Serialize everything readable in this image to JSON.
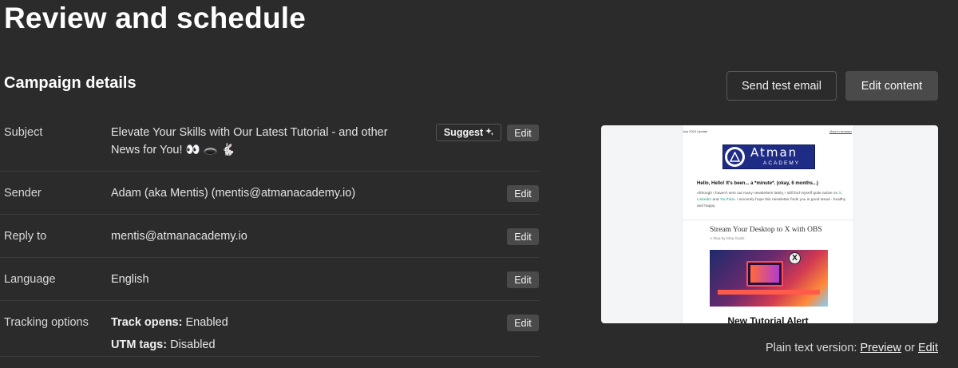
{
  "page": {
    "title": "Review and schedule"
  },
  "campaign": {
    "section_title": "Campaign details",
    "send_test_label": "Send test email",
    "edit_content_label": "Edit content",
    "suggest_label": "Suggest",
    "edit_label": "Edit",
    "rows": {
      "subject": {
        "label": "Subject",
        "value_line1": "Elevate Your Skills with Our Latest Tutorial - and other",
        "value_line2": "News for You! 👀 🕳️ 🐇"
      },
      "sender": {
        "label": "Sender",
        "value": "Adam (aka Mentis) (mentis@atmanacademy.io)"
      },
      "reply_to": {
        "label": "Reply to",
        "value": "mentis@atmanacademy.io"
      },
      "language": {
        "label": "Language",
        "value": "English"
      },
      "tracking": {
        "label": "Tracking options",
        "opens_key": "Track opens:",
        "opens_value": "Enabled",
        "utm_key": "UTM tags:",
        "utm_value": "Disabled"
      }
    }
  },
  "preview": {
    "top_left": "July 2024 Update",
    "top_right": "View in browser",
    "logo_name": "Atman",
    "logo_sub": "ACADEMY",
    "hello": "Hello, Hello! It's been... a *minute*. (okay, 6 months...)",
    "para_part1": "Although I haven't sent out many newsletters lately, I still find myself quite active on ",
    "link_x": "X",
    "link_linkedin": "LinkedIn",
    "link_youtube": "YouTube",
    "para_part2": ". I sincerely hope this newsletter finds you in good stead - healthy and happy.",
    "article_title": "Stream Your Desktop to X with OBS",
    "article_sub": "A Step-by-Step Guide",
    "x_glyph": "X",
    "alert": "New Tutorial Alert"
  },
  "plain_text": {
    "prefix": "Plain text version:",
    "preview_link": "Preview",
    "or": "or",
    "edit_link": "Edit"
  }
}
